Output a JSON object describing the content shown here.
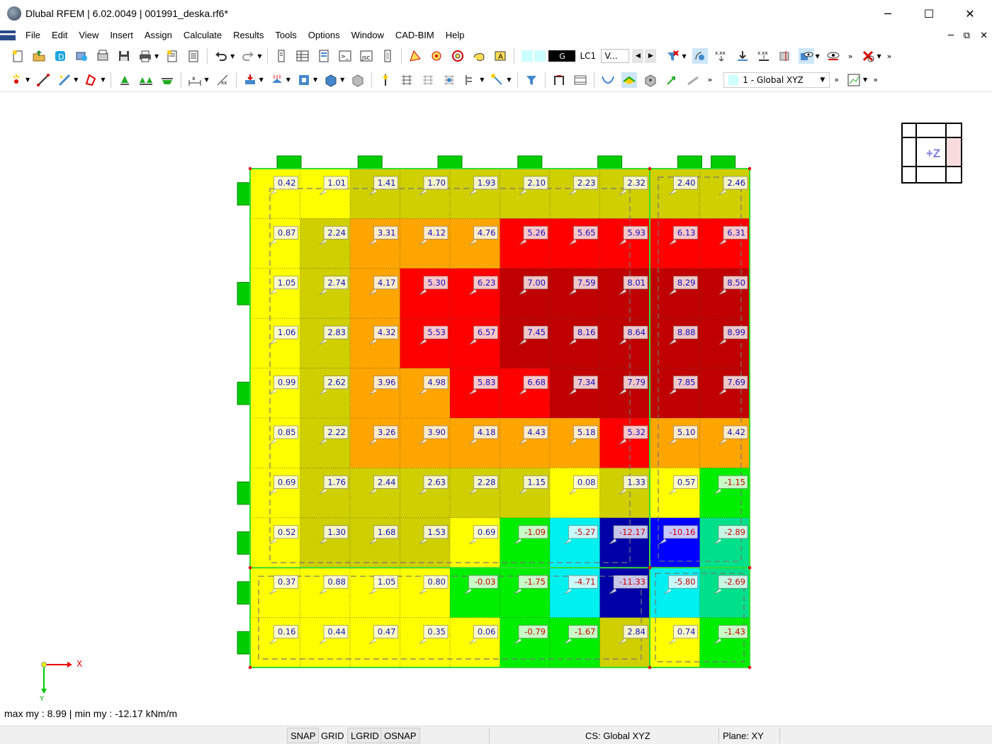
{
  "window": {
    "title": "Dlubal RFEM | 6.02.0049 | 001991_deska.rf6*",
    "minimize": "─",
    "maximize": "☐",
    "close": "✕"
  },
  "menu": {
    "items": [
      "File",
      "Edit",
      "View",
      "Insert",
      "Assign",
      "Calculate",
      "Results",
      "Tools",
      "Options",
      "Window",
      "CAD-BIM",
      "Help"
    ],
    "mdi_controls": [
      "─",
      "⧉",
      "✕"
    ]
  },
  "toolbar1": {
    "load_case_color_label": "G",
    "load_case": "LC1",
    "load_case_combo": "V...",
    "prev": "◀",
    "next": "▶"
  },
  "toolbar2": {
    "coordinate_system": "1 - Global XYZ"
  },
  "navigation_cube": {
    "label": "+Z"
  },
  "axes": {
    "x": "X",
    "y": "Y"
  },
  "result_info": "max my : 8.99 | min my : -12.17 kNm/m",
  "plate": {
    "rows": [
      [
        "0.42",
        "1.01",
        "1.41",
        "1.70",
        "1.93",
        "2.10",
        "2.23",
        "2.32",
        "2.40",
        "2.46"
      ],
      [
        "0.87",
        "2.24",
        "3.31",
        "4.12",
        "4.76",
        "5.26",
        "5.65",
        "5.93",
        "6.13",
        "6.31"
      ],
      [
        "1.05",
        "2.74",
        "4.17",
        "5.30",
        "6.23",
        "7.00",
        "7.59",
        "8.01",
        "8.29",
        "8.50"
      ],
      [
        "1.06",
        "2.83",
        "4.32",
        "5.53",
        "6.57",
        "7.45",
        "8.16",
        "8.64",
        "8.88",
        "8.99"
      ],
      [
        "0.99",
        "2.62",
        "3.96",
        "4.98",
        "5.83",
        "6.68",
        "7.34",
        "7.79",
        "7.85",
        "7.69"
      ],
      [
        "0.85",
        "2.22",
        "3.26",
        "3.90",
        "4.18",
        "4.43",
        "5.18",
        "5.32",
        "5.10",
        "4.42"
      ],
      [
        "0.69",
        "1.76",
        "2.44",
        "2.63",
        "2.28",
        "1.15",
        "0.08",
        "1.33",
        "0.57",
        "-1.15"
      ],
      [
        "0.52",
        "1.30",
        "1.68",
        "1.53",
        "0.69",
        "-1.09",
        "-5.27",
        "-12.17",
        "-10.16",
        "-2.89"
      ],
      [
        "0.37",
        "0.88",
        "1.05",
        "0.80",
        "-0.03",
        "-1.75",
        "-4.71",
        "-11.33",
        "-5.80",
        "-2.69"
      ],
      [
        "0.16",
        "0.44",
        "0.47",
        "0.35",
        "0.06",
        "-0.79",
        "-1.67",
        "2.84",
        "0.74",
        "-1.43"
      ]
    ],
    "colors": {
      "yellow": "#ffff00",
      "olive": "#d0cf00",
      "orange": "#ffa500",
      "red": "#ff0000",
      "darkred": "#c00000",
      "green": "#00ee00",
      "teal": "#00e08a",
      "cyan": "#00f0f0",
      "blue": "#0000ff",
      "navy": "#0000a8"
    }
  },
  "statusbar": {
    "snap": "SNAP",
    "grid": "GRID",
    "lgrid": "LGRID",
    "osnap": "OSNAP",
    "cs": "CS: Global XYZ",
    "plane": "Plane: XY"
  }
}
